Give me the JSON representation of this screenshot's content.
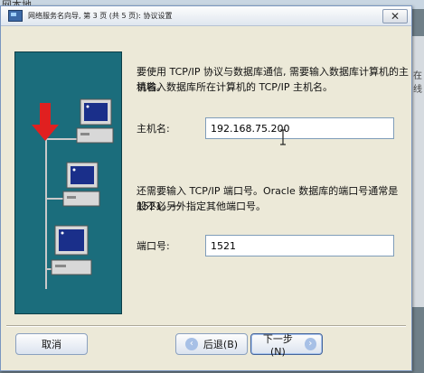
{
  "desktop": {
    "label": "网本地",
    "side_text": "在线"
  },
  "window": {
    "title": "网络服务名向导, 第 3 页 (共 5 页): 协议设置",
    "close_symbol": "✕"
  },
  "form": {
    "intro_line1": "要使用 TCP/IP 协议与数据库通信, 需要输入数据库计算机的主机名。",
    "intro_line2": "请输入数据库所在计算机的 TCP/IP 主机名。",
    "host_label": "主机名:",
    "host_value": "192.168.75.200",
    "port_intro_line1": "还需要输入 TCP/IP 端口号。Oracle 数据库的端口号通常是 1521。一",
    "port_intro_line2": "般不必另外指定其他端口号。",
    "port_label": "端口号:",
    "port_value": "1521"
  },
  "buttons": {
    "cancel": "取消",
    "back": "后退(B)",
    "next": "下一步(N)",
    "back_arrow": "‹",
    "next_arrow": "›"
  },
  "colors": {
    "illustration_bg": "#1b6d7c",
    "arrow": "#e02020"
  }
}
